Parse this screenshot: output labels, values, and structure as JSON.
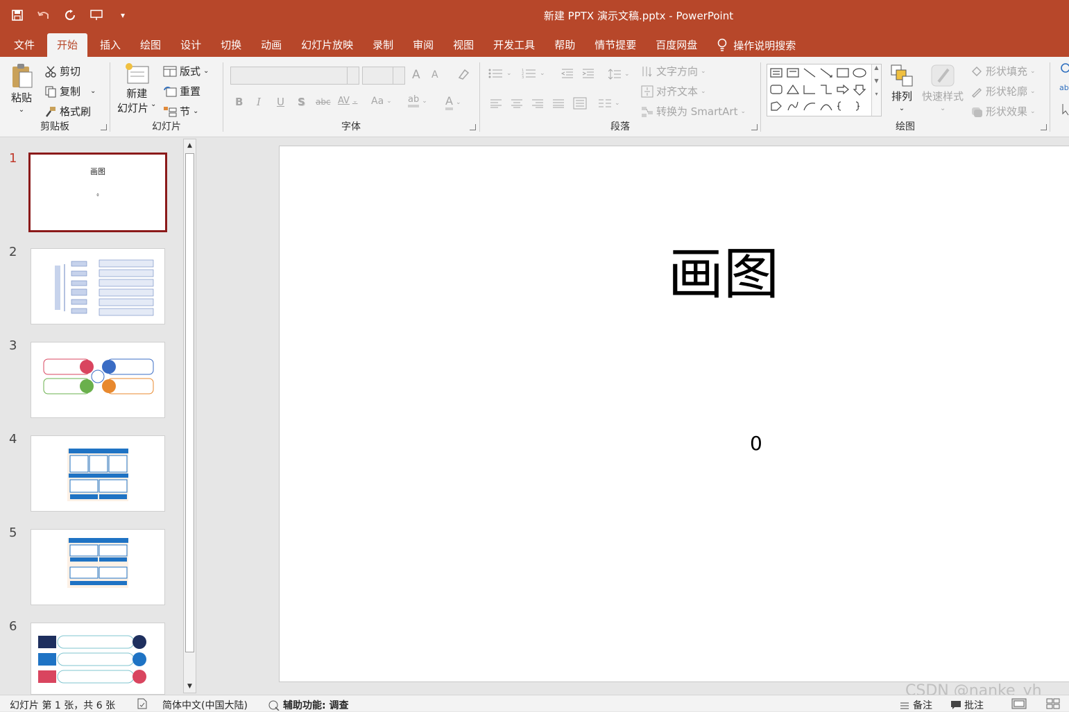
{
  "window": {
    "title": "新建 PPTX 演示文稿.pptx  -  PowerPoint",
    "brand_color": "#b7472a"
  },
  "quick_access": [
    "save-icon",
    "undo-icon",
    "redo-icon",
    "present-icon",
    "customize-icon"
  ],
  "menu_tabs": [
    "文件",
    "开始",
    "插入",
    "绘图",
    "设计",
    "切换",
    "动画",
    "幻灯片放映",
    "录制",
    "审阅",
    "视图",
    "开发工具",
    "帮助",
    "情节提要",
    "百度网盘"
  ],
  "active_tab": "开始",
  "tell_me": "操作说明搜索",
  "ribbon": {
    "clipboard": {
      "label": "剪贴板",
      "paste": "粘贴",
      "cut": "剪切",
      "copy": "复制",
      "format_painter": "格式刷"
    },
    "slides": {
      "label": "幻灯片",
      "new_slide_line1": "新建",
      "new_slide_line2": "幻灯片",
      "layout": "版式",
      "reset": "重置",
      "section": "节"
    },
    "font": {
      "label": "字体",
      "bold": "B",
      "italic": "I",
      "underline": "U",
      "shadow": "S",
      "strike": "abc",
      "spacing": "AV",
      "case": "Aa",
      "grow": "A",
      "shrink": "A",
      "color": "A",
      "highlight": "ab"
    },
    "paragraph": {
      "label": "段落",
      "text_direction": "文字方向",
      "align_text": "对齐文本",
      "smartart": "转换为 SmartArt"
    },
    "drawing": {
      "label": "绘图",
      "arrange": "排列",
      "quick_styles": "快速样式",
      "shape_fill": "形状填充",
      "shape_outline": "形状轮廓",
      "shape_effects": "形状效果"
    }
  },
  "thumbnails": [
    {
      "number": "1",
      "title": "画图",
      "sub": "0"
    },
    {
      "number": "2"
    },
    {
      "number": "3"
    },
    {
      "number": "4"
    },
    {
      "number": "5"
    },
    {
      "number": "6"
    }
  ],
  "slide": {
    "title": "画图",
    "subtitle": "0"
  },
  "status": {
    "slide_info": "幻灯片 第 1 张，共 6 张",
    "language": "简体中文(中国大陆)",
    "accessibility": "辅助功能: 调查",
    "notes": "备注",
    "comments": "批注"
  },
  "watermark": "CSDN @nanke_yh"
}
